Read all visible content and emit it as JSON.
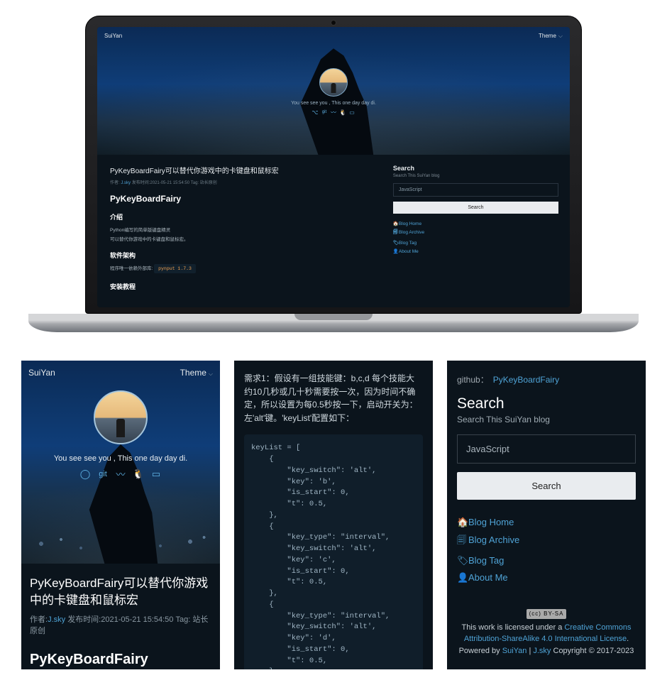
{
  "brand": "SuiYan",
  "theme_label": "Theme",
  "tagline": "You see see you , This one day day di.",
  "social_icons": [
    "github-icon",
    "git-text",
    "weibo-icon",
    "qq-icon",
    "book-icon"
  ],
  "article": {
    "title": "PyKeyBoardFairy可以替代你游戏中的卡键盘和鼠标宏",
    "meta_author_label": "作者:",
    "author": "J.sky",
    "meta_time_label": "发布时间:",
    "time": "2021-05-21 15:54:50",
    "meta_tag_label": "Tag:",
    "tag": "站长原创",
    "h1": "PyKeyBoardFairy",
    "intro_h": "介绍",
    "p1": "Python编写的简单版键盘精灵",
    "p2": "可以替代你游戏中的卡键盘和鼠标宏。",
    "arch_h": "软件架构",
    "deps_label": "程序唯一依赖外部库:",
    "deps": "pynput 1.7.3",
    "last": "安装教程"
  },
  "search": {
    "title": "Search",
    "sub": "Search This SuiYan blog",
    "placeholder": "JavaScript",
    "button": "Search"
  },
  "nav": [
    {
      "icon": "🏠",
      "label": "Blog Home"
    },
    {
      "icon": "🗐",
      "label": "Blog Archive"
    },
    {
      "icon": "🏷",
      "label": "Blog Tag"
    },
    {
      "icon": "👤",
      "label": "About Me"
    }
  ],
  "card2": {
    "paragraph": "需求1：假设有一组技能键：b,c,d 每个技能大约10几秒或几十秒需要按一次，因为时间不确定，所以设置为每0.5秒按一下，启动开关为：左'alt'键。'keyList'配置如下：",
    "code": "keyList = [\n    {\n        \"key_switch\": 'alt',\n        \"key\": 'b',\n        \"is_start\": 0,\n        \"t\": 0.5,\n    },\n    {\n        \"key_type\": \"interval\",\n        \"key_switch\": 'alt',\n        \"key\": 'c',\n        \"is_start\": 0,\n        \"t\": 0.5,\n    },\n    {\n        \"key_type\": \"interval\",\n        \"key_switch\": 'alt',\n        \"key\": 'd',\n        \"is_start\": 0,\n        \"t\": 0.5,\n    },"
  },
  "card3": {
    "gh_label": "github：",
    "gh_link": "PyKeyBoardFairy",
    "cc": "(cc) BY-SA",
    "lic1": "This work is licensed under a ",
    "lic_link": "Creative Commons Attribution-ShareAlike 4.0 International License",
    "lic2": ".",
    "pow1": "Powered by ",
    "pow_link1": "SuiYan",
    "pow_sep": " | ",
    "pow_link2": "J.sky",
    "copyright": " Copyright © 2017-2023"
  }
}
